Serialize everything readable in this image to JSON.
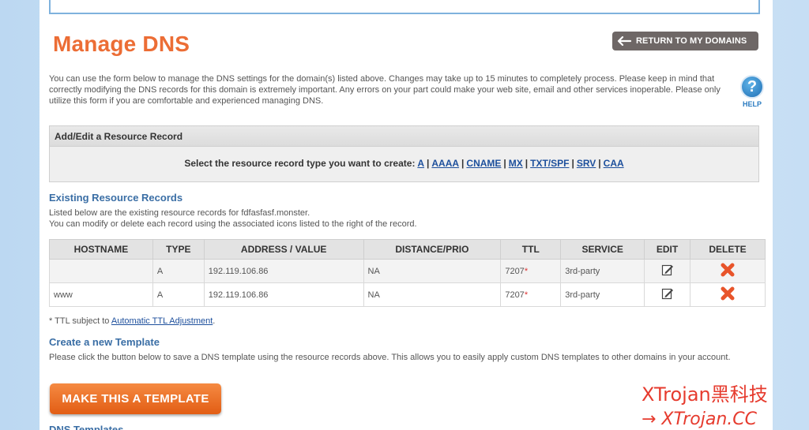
{
  "page": {
    "title": "Manage DNS",
    "back_button_label": "RETURN TO MY DOMAINS",
    "intro": "You can use the form below to manage the DNS settings for the domain(s) listed above. Changes may take up to 15 minutes to completely process. Please keep in mind that correctly modifying the DNS records for this domain is extremely important. Any errors on your part could make your web site, email and other services inoperable. Please only utilize this form if you are comfortable and experienced managing DNS.",
    "help_label": "HELP",
    "help_glyph": "?"
  },
  "add_record": {
    "header": "Add/Edit a Resource Record",
    "prompt": "Select the resource record type you want to create:",
    "types": [
      "A",
      "AAAA",
      "CNAME",
      "MX",
      "TXT/SPF",
      "SRV",
      "CAA"
    ],
    "separator": "|"
  },
  "existing": {
    "title": "Existing Resource Records",
    "line1": "Listed below are the existing resource records for fdfasfasf.monster.",
    "line2": "You can modify or delete each record using the associated icons listed to the right of the record.",
    "columns": [
      "HOSTNAME",
      "TYPE",
      "ADDRESS / VALUE",
      "DISTANCE/PRIO",
      "TTL",
      "SERVICE",
      "EDIT",
      "DELETE"
    ],
    "rows": [
      {
        "hostname": "",
        "type": "A",
        "address": "192.119.106.86",
        "distance": "NA",
        "ttl": "7207",
        "ttl_mark": "*",
        "service": "3rd-party"
      },
      {
        "hostname": "www",
        "type": "A",
        "address": "192.119.106.86",
        "distance": "NA",
        "ttl": "7207",
        "ttl_mark": "*",
        "service": "3rd-party"
      }
    ]
  },
  "footnote": {
    "prefix": "* TTL subject to",
    "link": "Automatic TTL Adjustment",
    "suffix": "."
  },
  "template": {
    "title": "Create a new Template",
    "text": "Please click the button below to save a DNS template using the resource records above. This allows you to easily apply custom DNS templates to other domains in your account.",
    "button_label": "MAKE THIS A TEMPLATE"
  },
  "next_section_title": "DNS Templates",
  "watermark": {
    "line1": "XTrojan黑科技",
    "line2": "→ XTrojan.CC"
  },
  "colors": {
    "title": "#ec6d35",
    "link": "#1d4f9c",
    "section_title": "#3a6ea5",
    "delete_icon": "#e8542a",
    "watermark": "#e63b2e"
  },
  "icons": [
    "arrow-left-icon",
    "help-icon",
    "edit-icon",
    "delete-icon"
  ]
}
